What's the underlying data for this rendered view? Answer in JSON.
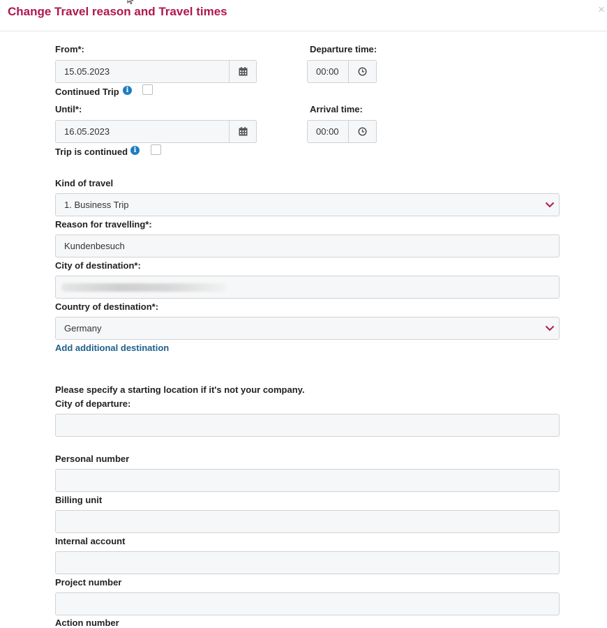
{
  "dialog": {
    "title": "Change Travel reason and Travel times",
    "close_label": "×"
  },
  "from": {
    "label": "From*:",
    "value": "15.05.2023",
    "icon": "calendar-icon"
  },
  "departure_time": {
    "label": "Departure time:",
    "value": "00:00",
    "icon": "clock-icon"
  },
  "continued_trip": {
    "label": "Continued Trip",
    "info_icon": "info-icon",
    "info_glyph": "i",
    "checked": false
  },
  "until": {
    "label": "Until*:",
    "value": "16.05.2023",
    "icon": "calendar-icon"
  },
  "arrival_time": {
    "label": "Arrival time:",
    "value": "00:00",
    "icon": "clock-icon"
  },
  "trip_is_continued": {
    "label": "Trip is continued",
    "info_icon": "info-icon",
    "info_glyph": "i",
    "checked": false
  },
  "kind_of_travel": {
    "label": "Kind of travel",
    "value": "1. Business Trip"
  },
  "reason": {
    "label": "Reason for travelling*:",
    "value": "Kundenbesuch"
  },
  "city_destination": {
    "label": "City of destination*:",
    "value": ""
  },
  "country_destination": {
    "label": "Country of destination*:",
    "value": "Germany"
  },
  "add_destination": {
    "label": "Add additional destination"
  },
  "starting_location_hint": "Please specify a starting location if it's not your company.",
  "city_departure": {
    "label": "City of departure:",
    "value": ""
  },
  "personal_number": {
    "label": "Personal number",
    "value": ""
  },
  "billing_unit": {
    "label": "Billing unit",
    "value": ""
  },
  "internal_account": {
    "label": "Internal account",
    "value": ""
  },
  "project_number": {
    "label": "Project number",
    "value": ""
  },
  "action_number": {
    "label": "Action number"
  },
  "colors": {
    "title": "#b0174f",
    "chevron": "#b0174f",
    "link": "#1f5f8b",
    "info": "#1b7ec2",
    "field_bg": "#f6f7f8",
    "field_border": "#cfd2d6"
  }
}
